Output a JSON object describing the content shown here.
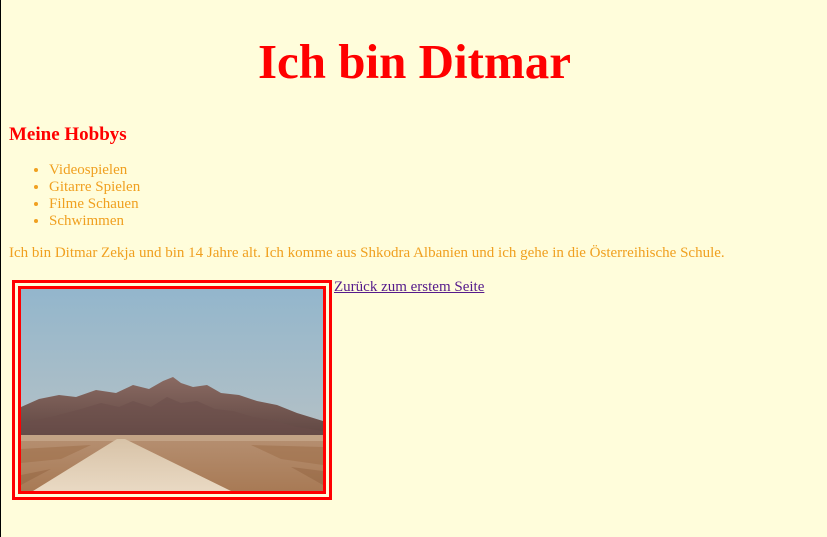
{
  "header": {
    "title": "Ich bin Ditmar"
  },
  "hobbies": {
    "heading": "Meine Hobbys",
    "items": [
      "Videospielen",
      "Gitarre Spielen",
      "Filme Schauen",
      "Schwimmen"
    ]
  },
  "intro": {
    "text": "Ich bin Ditmar Zekja und bin 14 Jahre alt. Ich komme aus Shkodra Albanien und ich gehe in die Österreihische Schule."
  },
  "media": {
    "icon": "desert-road-mountain-photo"
  },
  "nav": {
    "back_link": "Zurück zum erstem Seite"
  },
  "colors": {
    "background": "#fffddb",
    "heading": "#ff0000",
    "body_text": "#f0a020",
    "link": "#551a8b",
    "frame": "#ff0000"
  }
}
